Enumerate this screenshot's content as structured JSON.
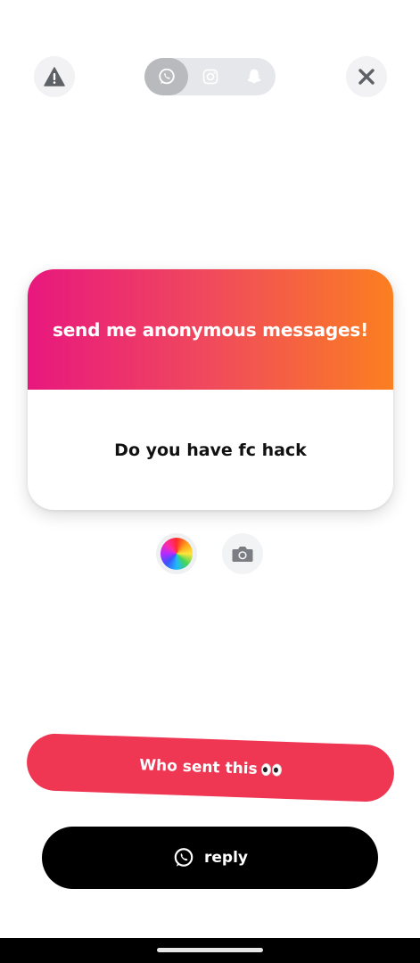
{
  "top_bar": {
    "report_icon": "warning-icon",
    "close_icon": "close-icon",
    "share_targets": [
      {
        "name": "whatsapp",
        "icon": "whatsapp-icon",
        "selected": true
      },
      {
        "name": "instagram",
        "icon": "instagram-icon",
        "selected": false
      },
      {
        "name": "snapchat",
        "icon": "snapchat-icon",
        "selected": false
      }
    ]
  },
  "card": {
    "header_text": "send me anonymous messages!",
    "message_text": "Do you have fc hack",
    "gradient": [
      "#e8177e",
      "#fb7f20"
    ]
  },
  "tools": {
    "color_icon": "color-wheel-icon",
    "camera_icon": "camera-icon"
  },
  "actions": {
    "who_sent_label": "Who sent this",
    "who_sent_emoji": "eyes-emoji",
    "reply_label": "reply",
    "reply_icon": "whatsapp-icon"
  },
  "colors": {
    "who_sent_bg": "#ef3653",
    "reply_bg": "#000000"
  }
}
